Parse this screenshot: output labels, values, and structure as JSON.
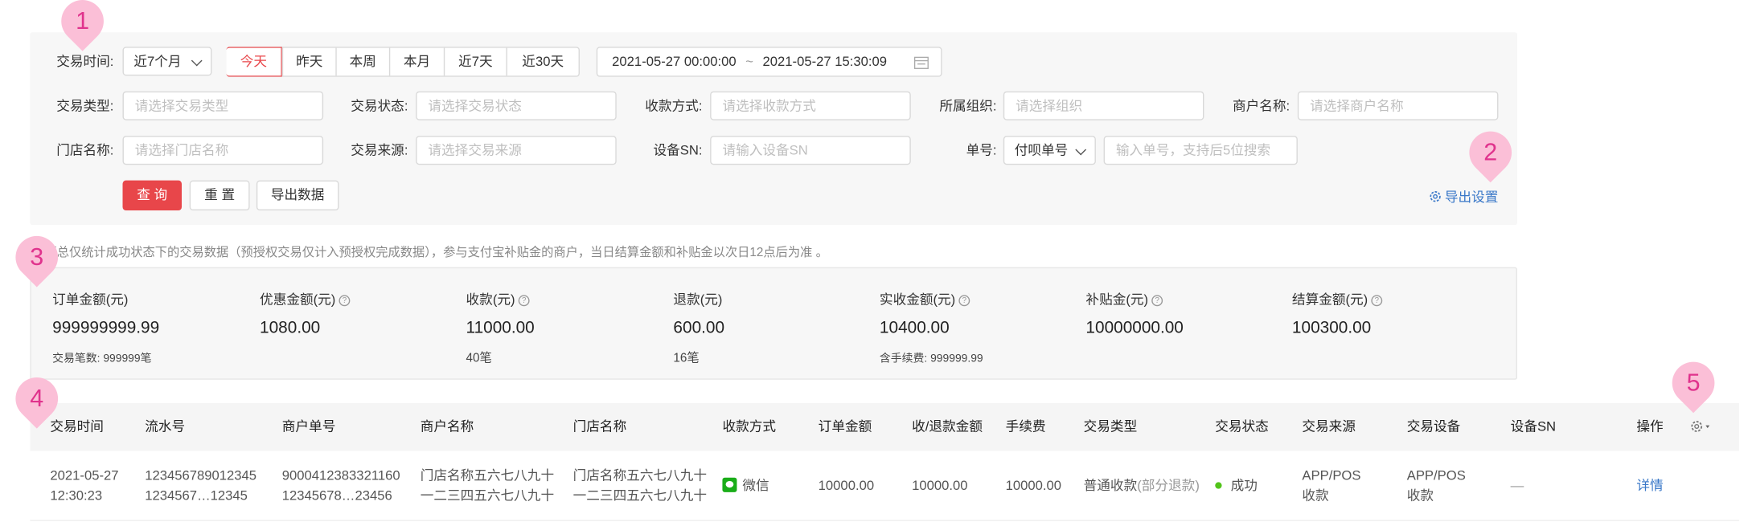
{
  "filters": {
    "time_label": "交易时间:",
    "time_range_select": "近7个月",
    "quick_tabs": [
      "今天",
      "昨天",
      "本周",
      "本月",
      "近7天",
      "近30天"
    ],
    "date_start": "2021-05-27 00:00:00",
    "date_sep": "~",
    "date_end": "2021-05-27 15:30:09",
    "trade_type_label": "交易类型:",
    "trade_type_placeholder": "请选择交易类型",
    "trade_status_label": "交易状态:",
    "trade_status_placeholder": "请选择交易状态",
    "pay_method_label": "收款方式:",
    "pay_method_placeholder": "请选择收款方式",
    "org_label": "所属组织:",
    "org_placeholder": "请选择组织",
    "merchant_label": "商户名称:",
    "merchant_placeholder": "请选择商户名称",
    "store_label": "门店名称:",
    "store_placeholder": "请选择门店名称",
    "source_label": "交易来源:",
    "source_placeholder": "请选择交易来源",
    "device_label": "设备SN:",
    "device_placeholder": "请输入设备SN",
    "order_label": "单号:",
    "order_type_select": "付呗单号",
    "order_placeholder": "输入单号，支持后5位搜索",
    "query_button": "查 询",
    "reset_button": "重 置",
    "export_button": "导出数据",
    "export_settings": "导出设置"
  },
  "note": "汇总仅统计成功状态下的交易数据（预授权交易仅计入预授权完成数据），参与支付宝补贴金的商户，当日结算金额和补贴金以次日12点后为准 。",
  "summary": [
    {
      "title": "订单金额(元)",
      "help": false,
      "value": "999999999.99",
      "sub": "交易笔数: 999999笔"
    },
    {
      "title": "优惠金额(元)",
      "help": true,
      "value": "1080.00",
      "sub": ""
    },
    {
      "title": "收款(元)",
      "help": true,
      "value": "11000.00",
      "sub": "40笔"
    },
    {
      "title": "退款(元)",
      "help": false,
      "value": "600.00",
      "sub": "16笔"
    },
    {
      "title": "实收金额(元)",
      "help": true,
      "value": "10400.00",
      "sub": "含手续费: 999999.99"
    },
    {
      "title": "补贴金(元)",
      "help": true,
      "value": "10000000.00",
      "sub": ""
    },
    {
      "title": "结算金额(元)",
      "help": true,
      "value": "100300.00",
      "sub": ""
    }
  ],
  "table": {
    "headers": [
      "交易时间",
      "流水号",
      "商户单号",
      "商户名称",
      "门店名称",
      "收款方式",
      "订单金额",
      "收/退款金额",
      "手续费",
      "交易类型",
      "交易状态",
      "交易来源",
      "交易设备",
      "设备SN",
      "操作"
    ],
    "row": {
      "time_l1": "2021-05-27",
      "time_l2": "12:30:23",
      "serial_l1": "123456789012345",
      "serial_l2": "1234567…12345",
      "merchant_no_l1": "9000412383321160",
      "merchant_no_l2": "12345678…23456",
      "merchant_name_l1": "门店名称五六七八九十",
      "merchant_name_l2": "一二三四五六七八九十",
      "store_name_l1": "门店名称五六七八九十",
      "store_name_l2": "一二三四五六七八九十",
      "pay_method": "微信",
      "order_amount": "10000.00",
      "recv_amount": "10000.00",
      "fee": "10000.00",
      "trade_type": "普通收款",
      "trade_type_note": "(部分退款)",
      "status": "成功",
      "source_l1": "APP/POS",
      "source_l2": "收款",
      "device_l1": "APP/POS",
      "device_l2": "收款",
      "device_sn": "—",
      "action": "详情"
    }
  },
  "markers": [
    "1",
    "2",
    "3",
    "4",
    "5"
  ],
  "colors": {
    "accent": "#e8464a",
    "link": "#3a78c8",
    "marker": "#fbbfd7",
    "marker_text": "#e0338d",
    "success": "#52c41a",
    "wechat": "#1aad19"
  }
}
